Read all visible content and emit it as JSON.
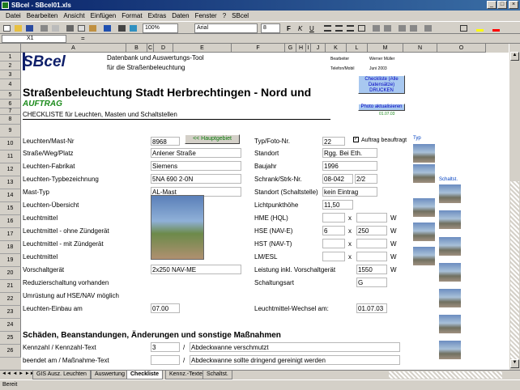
{
  "window": {
    "title": "SBcel - SBcel01.xls"
  },
  "menu": [
    "Datei",
    "Bearbeiten",
    "Ansicht",
    "Einfügen",
    "Format",
    "Extras",
    "Daten",
    "Fenster",
    "?",
    "SBcel"
  ],
  "toolbar": {
    "zoom": "100%",
    "font": "Arial",
    "size": "8"
  },
  "formula": {
    "namebox": "X1",
    "content": ""
  },
  "columns": [
    "A",
    "B",
    "C",
    "D",
    "E",
    "F",
    "G",
    "H",
    "I",
    "J",
    "K",
    "L",
    "M",
    "N",
    "O"
  ],
  "rows": [
    "1",
    "2",
    "3",
    "4",
    "5",
    "6",
    "7",
    "8",
    "9",
    "10",
    "11",
    "12",
    "13",
    "14",
    "15",
    "16",
    "17",
    "18",
    "19",
    "20",
    "21",
    "22",
    "23",
    "24",
    "25",
    "26"
  ],
  "header": {
    "logo": "SBcel",
    "desc1": "Datenbank und Auswertungs-Tool",
    "desc2": "für die Straßenbeleuchtung",
    "title": "Straßenbeleuchtung Stadt Herbrechtingen - Nord und",
    "subtitle": "AUFTRAG",
    "checklist": "CHECKLISTE für Leuchten, Masten und Schaltstellen",
    "info1": "Bearbeiter",
    "info1val": "Werner Müller",
    "info2": "Telefon/Mobil",
    "info2val": "Juni 2003",
    "print_btn": "Checkliste (Alle Datensätze) DRUCKEN",
    "photo_btn": "Photo aktualisieren",
    "date": "01.07.03"
  },
  "form": {
    "mast_nr_label": "Leuchten/Mast-Nr",
    "mast_nr": "8968",
    "main_btn": "<< Hauptgebiet",
    "street_label": "Straße/Weg/Platz",
    "street": "Anlener Straße",
    "maker_label": "Leuchten-Fabrikat",
    "maker": "Siemens",
    "type_label": "Leuchten-Typbezeichnung",
    "type": "5NA 690 2-0N",
    "masttype_label": "Mast-Typ",
    "masttype": "AL-Mast",
    "lbl14": "Leuchten-Übersicht",
    "lbl15": "Leuchtmittel",
    "lbl16": "Leuchtmittel - ohne Zündgerät",
    "lbl17": "Leuchtmittel - mit Zündgerät",
    "lbl18": "Leuchtmittel",
    "vsg_label": "Vorschaltgerät",
    "vsg": "2x250 NAV-ME",
    "red_label": "Reduzierschaltung vorhanden",
    "umr_label": "Umrüstung auf HSE/NAV möglich",
    "date_label": "Leuchten-Einbau am",
    "date": "07.00",
    "photo_label": "Typ/Foto-Nr.",
    "photo_nr": "22",
    "checkbox_label": "Auftrag beauftragt",
    "standort_label": "Standort",
    "standort": "Rgg. Bei Eth.",
    "baujahr_label": "Baujahr",
    "baujahr": "1996",
    "schrank_label": "Schrank/Strk-Nr.",
    "schrank": "08-042",
    "schrank2": "2/2",
    "standort2_label": "Standort (Schaltstelle)",
    "standort2": "kein Eintrag",
    "lph_label": "Lichtpunkthöhe",
    "lph": "11,50",
    "hme_label": "HME (HQL)",
    "hse_label": "HSE (NAV-E)",
    "hse_qty": "6",
    "hse_w": "250",
    "hst_label": "HST (NAV-T)",
    "lm_label": "LM/ESL",
    "x": "x",
    "w": "W",
    "leistung_label": "Leistung inkl. Vorschaltgerät",
    "leistung": "1550",
    "schalt_label": "Schaltungsart",
    "schalt": "G",
    "wechsel_label": "Leuchtmittel-Wechsel am:",
    "wechsel": "01.07.03"
  },
  "section2": {
    "title": "Schäden, Beanstandungen, Änderungen und sonstige Maßnahmen",
    "row25_label": "Kennzahl / Kennzahl-Text",
    "row25_num": "3",
    "row25_text": "Abdeckwanne verschmutzt",
    "row26_label": "beendet am / Maßnahme-Text",
    "row26_text": "Abdeckwanne sollte dringend gereinigt werden"
  },
  "sidebar": {
    "typ_label": "Typ",
    "schalt_label": "Schaltst."
  },
  "tabs": [
    "GIS Ausz. Leuchten",
    "Auswertung",
    "Checkliste",
    "Kennz.-Texte",
    "Schaltst."
  ],
  "status": "Bereit"
}
